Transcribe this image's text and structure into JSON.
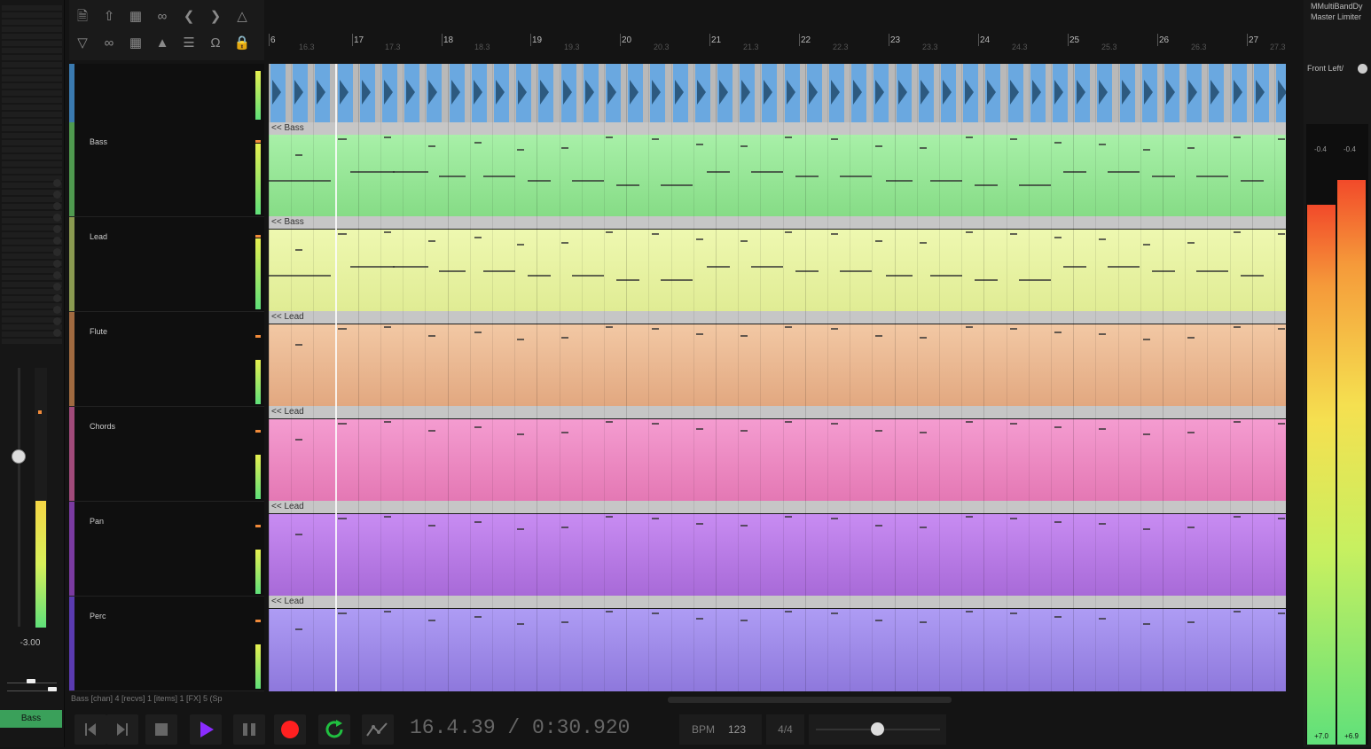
{
  "toolbar": {
    "icons": [
      "new-file-icon",
      "open-file-icon",
      "save-icon",
      "attach-icon",
      "undo-icon",
      "redo-icon",
      "metronome-icon",
      "envelope-icon",
      "link-icon",
      "grid-icon",
      "ripple-icon",
      "bars-icon",
      "magnet-icon",
      "lock-icon"
    ]
  },
  "left_mixer": {
    "volume": "-3.00",
    "channel_name": "Bass"
  },
  "tracks": [
    {
      "name": "",
      "color": "#3a7ab0"
    },
    {
      "name": "Bass",
      "color": "#4f9a4f"
    },
    {
      "name": "Lead",
      "color": "#8a9a50"
    },
    {
      "name": "Flute",
      "color": "#a06a40"
    },
    {
      "name": "Chords",
      "color": "#a04a7a"
    },
    {
      "name": "Pan",
      "color": "#7a3aa0"
    },
    {
      "name": "Perc",
      "color": "#5a3ab0"
    }
  ],
  "ruler": {
    "bars": [
      "6",
      "17",
      "18",
      "19",
      "20",
      "21",
      "22",
      "23",
      "24",
      "25",
      "26",
      "27"
    ],
    "subs": [
      "16.3",
      "17.3",
      "18.3",
      "19.3",
      "20.3",
      "21.3",
      "22.3",
      "23.3",
      "24.3",
      "25.3",
      "26.3",
      "27.3"
    ]
  },
  "lanes": [
    {
      "header": "<< Bass",
      "color_top": "#a8f0a8",
      "color_bottom": "#86dc86"
    },
    {
      "header": "<< Bass",
      "color_top": "#eef8b0",
      "color_bottom": "#e0ec94"
    },
    {
      "header": "<< Lead",
      "color_top": "#f2c8a4",
      "color_bottom": "#e2a880"
    },
    {
      "header": "<< Lead",
      "color_top": "#f49cd0",
      "color_bottom": "#e478b4"
    },
    {
      "header": "<< Lead",
      "color_top": "#c88cf2",
      "color_bottom": "#a86ad8"
    },
    {
      "header": "<< Lead",
      "color_top": "#ae9cf4",
      "color_bottom": "#8e78dc"
    }
  ],
  "status": {
    "text": "Bass [chan] 4 [recvs] 1 [items] 1 [FX] 5 (Sp"
  },
  "transport": {
    "time": "16.4.39 / 0:30.920",
    "bpm_label": "BPM",
    "bpm_value": "123",
    "time_signature": "4/4"
  },
  "right_panel": {
    "fx": [
      "MMultiBandDy",
      "Master Limiter"
    ],
    "channel_mode": "Front Left/",
    "meter_peak_left": "-0.4",
    "meter_peak_right": "-0.4",
    "meter_bottom_left": "+7.0",
    "meter_bottom_right": "+6.9",
    "meter_level_left": 0.87,
    "meter_level_right": 0.91
  },
  "colors": {
    "record": "#ff2020",
    "play": "#8a2cff",
    "loop": "#20c040",
    "drum_lane": "#6aa8e0"
  }
}
